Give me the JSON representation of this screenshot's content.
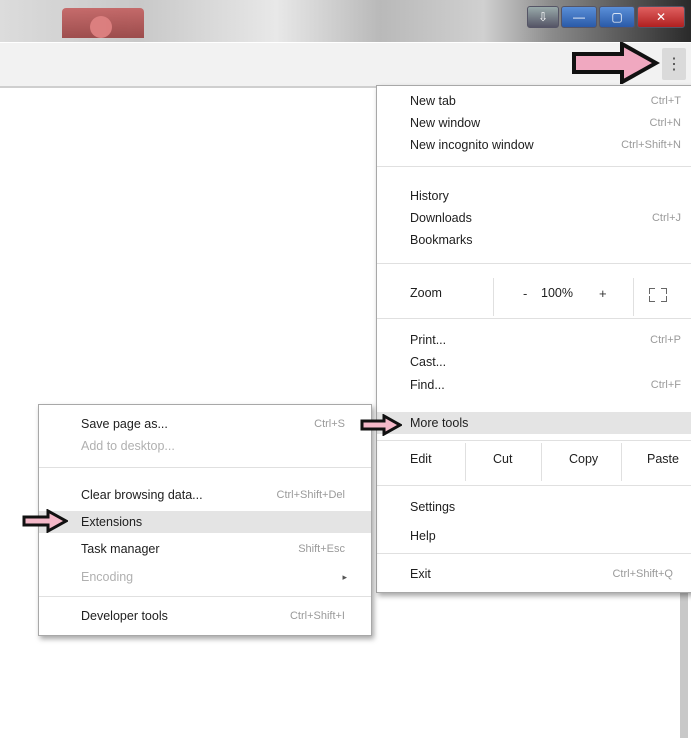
{
  "window": {
    "minimize_label": "—",
    "maximize_label": "▢",
    "close_label": "✕",
    "alt_label": "⇩"
  },
  "toolbar": {
    "menu_icon": "⋮"
  },
  "main_menu": {
    "group1": [
      {
        "label": "New tab",
        "shortcut": "Ctrl+T"
      },
      {
        "label": "New window",
        "shortcut": "Ctrl+N"
      },
      {
        "label": "New incognito window",
        "shortcut": "Ctrl+Shift+N"
      }
    ],
    "group2": [
      {
        "label": "History",
        "chevron": "▸"
      },
      {
        "label": "Downloads",
        "shortcut": "Ctrl+J"
      },
      {
        "label": "Bookmarks",
        "chevron": "▸"
      }
    ],
    "zoom": {
      "label": "Zoom",
      "minus": "-",
      "value": "100%",
      "plus": "+"
    },
    "group3": [
      {
        "label": "Print...",
        "shortcut": "Ctrl+P"
      },
      {
        "label": "Cast..."
      },
      {
        "label": "Find...",
        "shortcut": "Ctrl+F"
      },
      {
        "label": "More tools",
        "chevron": "▸"
      }
    ],
    "edit": {
      "label": "Edit",
      "cut": "Cut",
      "copy": "Copy",
      "paste": "Paste"
    },
    "group4": [
      {
        "label": "Settings"
      },
      {
        "label": "Help",
        "chevron": "▸"
      }
    ],
    "exit": {
      "label": "Exit",
      "shortcut": "Ctrl+Shift+Q"
    }
  },
  "sub_menu": {
    "items": [
      {
        "label": "Save page as...",
        "shortcut": "Ctrl+S"
      },
      {
        "label": "Add to desktop..."
      },
      {
        "label": "Clear browsing data...",
        "shortcut": "Ctrl+Shift+Del"
      },
      {
        "label": "Extensions"
      },
      {
        "label": "Task manager",
        "shortcut": "Shift+Esc"
      },
      {
        "label": "Encoding",
        "chevron": "▸"
      },
      {
        "label": "Developer tools",
        "shortcut": "Ctrl+Shift+I"
      }
    ]
  },
  "colors": {
    "pink_arrow": "#f0a8c0",
    "black_arrow_fill": "#f4b8c8",
    "highlight": "#e4e4e4"
  }
}
